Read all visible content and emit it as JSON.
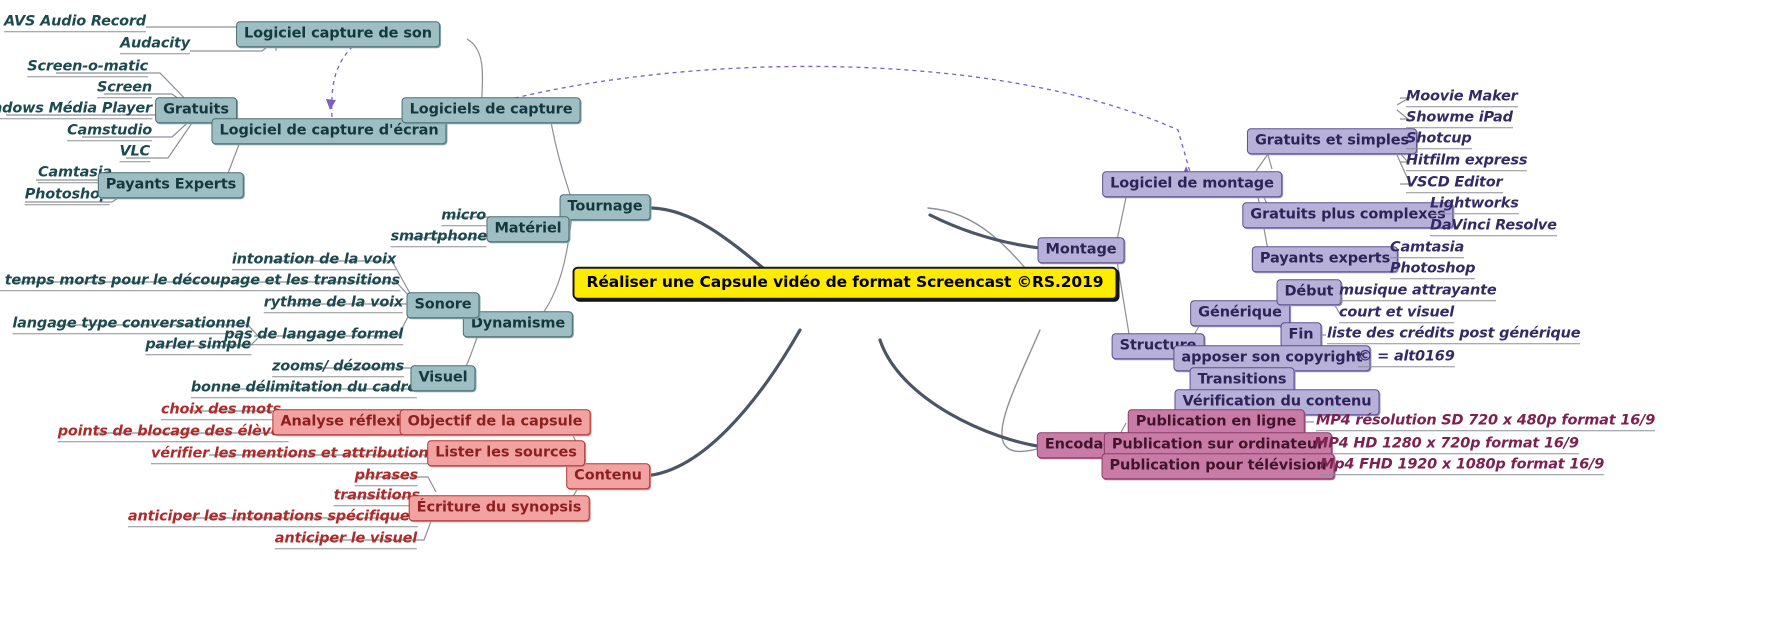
{
  "title": "Réaliser une Capsule vidéo de format Screencast ©RS.2019",
  "colors": {
    "center_fill": "#ffeb00",
    "teal_fill": "#9dbec2",
    "purple_fill": "#b7b0d9",
    "red_fill": "#f3a2a2",
    "pink_fill": "#c87ba6",
    "connector": "#8c9096",
    "trunk": "#4c5566",
    "dashed_link": "#7b5fc4"
  },
  "nodes": {
    "logiciel_capture_son": "Logiciel capture de son",
    "avs_audio_record": "AVS Audio Record",
    "audacity": "Audacity",
    "logiciel_capture_ecran": "Logiciel de capture d'écran",
    "gratuits": "Gratuits",
    "screen_o_matic": "Screen-o-matic",
    "screen": "Screen",
    "windows_media_player": "Windows Média Player",
    "camstudio": "Camstudio",
    "vlc": "VLC",
    "payants_experts": "Payants Experts",
    "camtasia_l": "Camtasia",
    "photoshop_l": "Photoshop",
    "logiciels_de_capture": "Logiciels de capture",
    "tournage": "Tournage",
    "materiel": "Matériel",
    "micro": "micro",
    "smartphone": "smartphone",
    "dynamisme": "Dynamisme",
    "sonore": "Sonore",
    "intonation": "intonation de la voix",
    "temps_morts": "prévoir des temps morts pour le découpage et les transitions",
    "rythme": "rythme de la voix",
    "langage_conv": "langage type conversationnel",
    "pas_langage_formel": "pas de langage formel",
    "parler_simple": "parler simple",
    "visuel": "Visuel",
    "zooms": "zooms/ dézooms",
    "delimitation": "bonne délimitation du cadre",
    "contenu": "Contenu",
    "objectif": "Objectif de la capsule",
    "analyse_reflexive": "Analyse réflexive",
    "choix_des_mots": "choix des mots",
    "points_blocage": "points de blocage des élèves",
    "lister_sources": "Lister les sources",
    "verifier_mentions": "vérifier les mentions et attributions",
    "ecriture_synopsis": "Écriture du synopsis",
    "phrases": "phrases",
    "transitions_l": "transitions",
    "anticiper_intonations": "anticiper les intonations spécifiques",
    "anticiper_visuel": "anticiper le visuel",
    "montage": "Montage",
    "logiciel_montage": "Logiciel de montage",
    "gratuits_simples": "Gratuits et simples",
    "moovie_maker": "Moovie Maker",
    "showme_ipad": "Showme iPad",
    "shotcup": "Shotcup",
    "hitfilm_express": "Hitfilm express",
    "vscd_editor": "VSCD Editor",
    "gratuits_complexes": "Gratuits plus complexes",
    "lightworks": "Lightworks",
    "davinci": "DaVinci Resolve",
    "payants_experts_r": "Payants experts",
    "camtasia_r": "Camtasia",
    "photoshop_r": "Photoshop",
    "structure": "Structure",
    "generique": "Générique",
    "debut": "Début",
    "musique": "musique attrayante",
    "court_visuel": "court et visuel",
    "fin": "Fin",
    "credits": "liste des crédits post générique",
    "copyright": "apposer son copyright",
    "alt0169": "© = alt0169",
    "transitions_node": "Transitions",
    "verification": "Vérification du contenu",
    "encodage": "Encodage",
    "pub_en_ligne": "Publication en ligne",
    "mp4_sd": "MP4 résolution SD 720 x 480p format 16/9",
    "pub_ordinateur": "Publication sur ordinateur",
    "mp4_hd": "MP4 HD 1280 x 720p format 16/9",
    "pub_television": "Publication pour télévision",
    "mp4_fhd": "Mp4 FHD 1920 x 1080p format 16/9"
  }
}
